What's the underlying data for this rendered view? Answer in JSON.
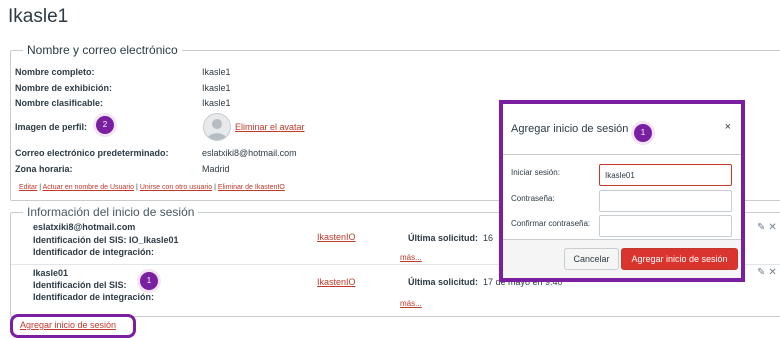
{
  "page_title": "Ikasle1",
  "profile": {
    "legend": "Nombre y correo electrónico",
    "fields": [
      {
        "label": "Nombre completo:",
        "value": "Ikasle1"
      },
      {
        "label": "Nombre de exhibición:",
        "value": "Ikasle1"
      },
      {
        "label": "Nombre clasificable:",
        "value": "Ikasle1"
      }
    ],
    "avatar_label": "Imagen de perfil:",
    "avatar_badge": "2",
    "remove_avatar": "Eliminar el avatar",
    "email_label": "Correo electrónico predeterminado:",
    "email_value": "eslatxiki8@hotmail.com",
    "tz_label": "Zona horaria:",
    "tz_value": "Madrid",
    "links": {
      "edit": "Editar",
      "act_as": "Actuar en nombre de Usuario",
      "merge": "Unirse con otro usuario",
      "delete": "Eliminar de IkastenIO",
      "sep": "|"
    }
  },
  "logins": {
    "legend": "Información del inicio de sesión",
    "items": [
      {
        "login": "eslatxiki8@hotmail.com",
        "sis_id": "Identificación del SIS: IO_Ikasle01",
        "integration": "Identificador de integración:",
        "provider": "IkastenIO",
        "last_request_label": "Última solicitud:",
        "last_request_value": "16",
        "more": "más..."
      },
      {
        "login": "Ikasle01",
        "sis_id": "Identificación del SIS:",
        "integration": "Identificador de integración:",
        "provider": "IkastenIO",
        "last_request_label": "Última solicitud:",
        "last_request_value": "17 de mayo en 9:40",
        "more": "más..."
      }
    ],
    "badge": "1",
    "add_login": "Agregar inicio de sesión",
    "edit_icons": "✎✕"
  },
  "modal": {
    "title": "Agregar inicio de sesión",
    "badge": "1",
    "close": "×",
    "login_label": "Iniciar sesión:",
    "login_value": "Ikasle01",
    "password_label": "Contraseña:",
    "confirm_label": "Confirmar contraseña:",
    "cancel": "Cancelar",
    "submit": "Agregar inicio de sesión"
  }
}
